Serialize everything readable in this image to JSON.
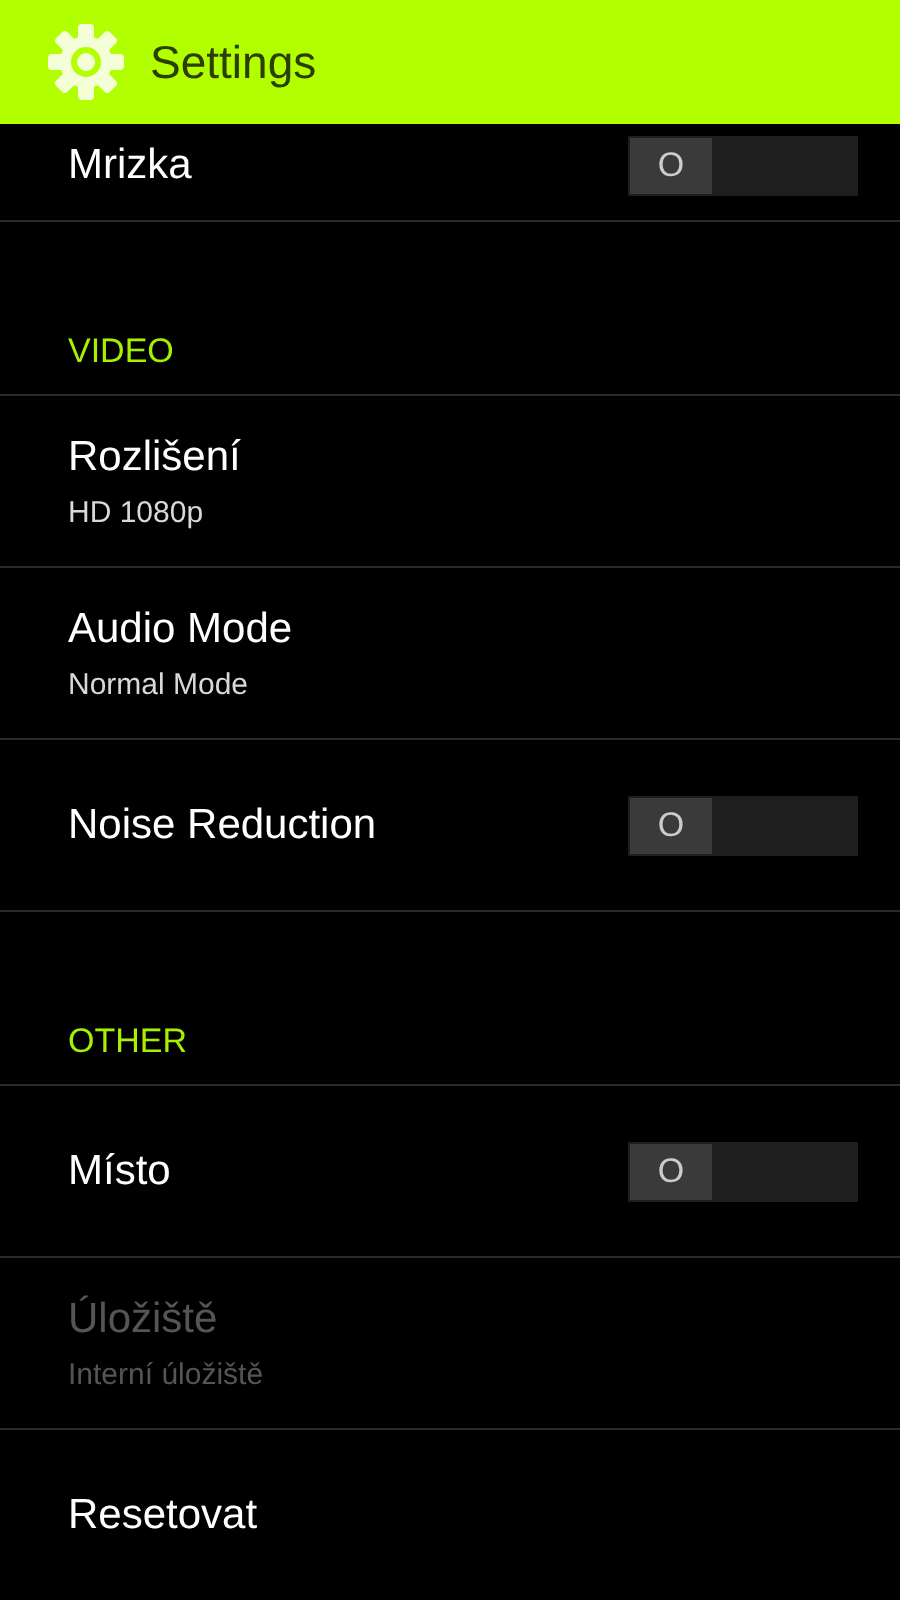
{
  "app_bar": {
    "title": "Settings"
  },
  "items": [
    {
      "kind": "toggle",
      "title": "Mrizka",
      "switch_label": "O",
      "on": false,
      "disabled": false
    },
    {
      "kind": "category",
      "title": "VIDEO"
    },
    {
      "kind": "detail",
      "title": "Rozlišení",
      "summary": "HD 1080p",
      "disabled": false
    },
    {
      "kind": "detail",
      "title": "Audio Mode",
      "summary": "Normal Mode",
      "disabled": false
    },
    {
      "kind": "toggle",
      "title": "Noise Reduction",
      "switch_label": "O",
      "on": false,
      "disabled": false
    },
    {
      "kind": "category",
      "title": "OTHER"
    },
    {
      "kind": "toggle",
      "title": "Místo",
      "switch_label": "O",
      "on": false,
      "disabled": false
    },
    {
      "kind": "detail",
      "title": "Úložiště",
      "summary": "Interní úložiště",
      "disabled": true
    },
    {
      "kind": "plain",
      "title": "Resetovat",
      "disabled": false
    }
  ]
}
